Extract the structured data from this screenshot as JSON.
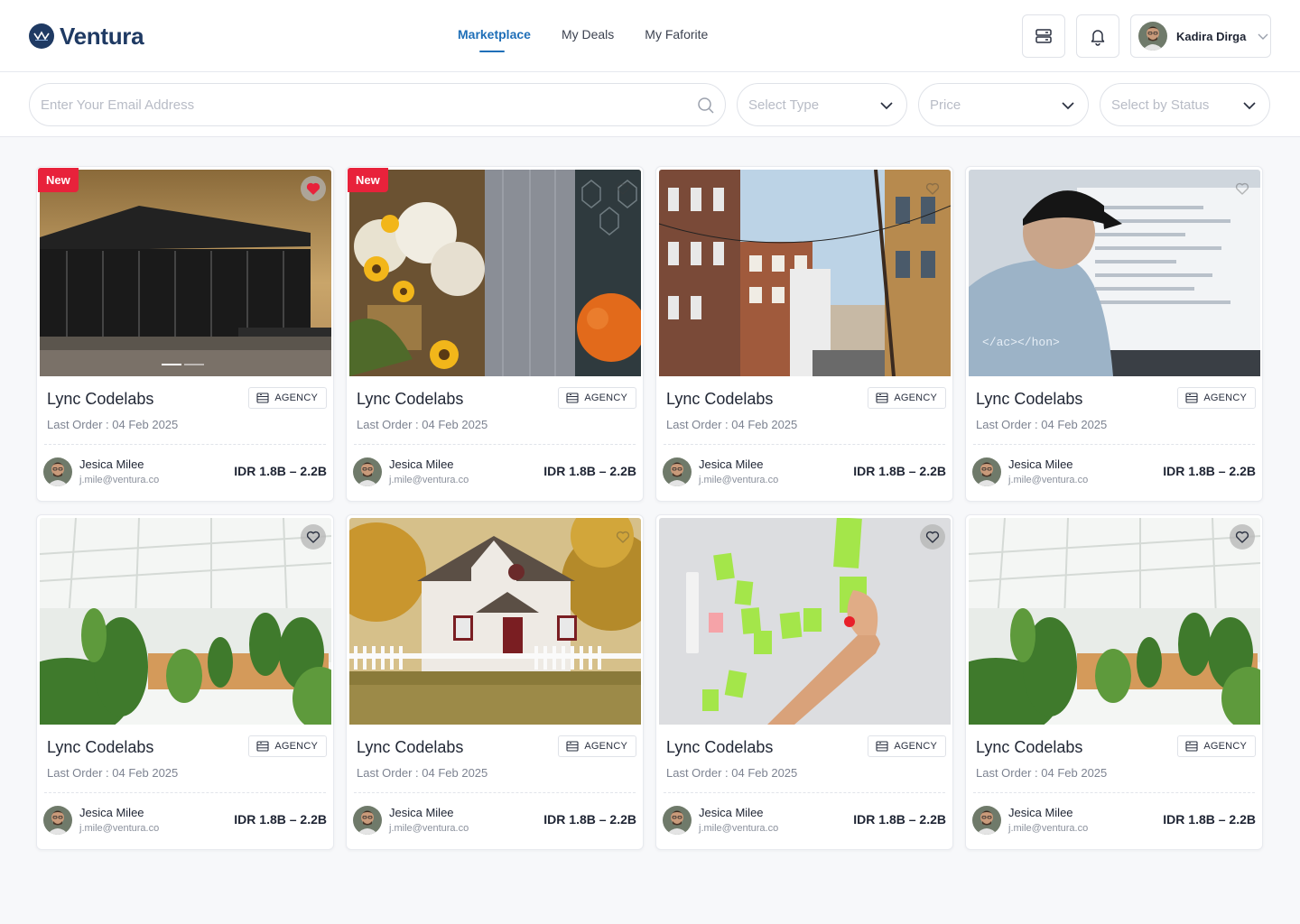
{
  "brand": {
    "name": "Ventura",
    "mark_text": "VENTURA"
  },
  "nav": [
    {
      "label": "Marketplace",
      "active": true
    },
    {
      "label": "My Deals",
      "active": false
    },
    {
      "label": "My Faforite",
      "active": false
    }
  ],
  "header_icons": [
    "server-icon",
    "bell-icon"
  ],
  "user": {
    "name": "Kadira Dirga"
  },
  "filters": {
    "search_placeholder": "Enter Your Email Address",
    "type_placeholder": "Select Type",
    "price_placeholder": "Price",
    "status_placeholder": "Select by Status"
  },
  "colors": {
    "brand": "#1f3a63",
    "accent": "#1f6fb8",
    "badge_new": "#e8223b",
    "favorite_active": "#e8223b"
  },
  "cards": [
    {
      "title": "Lync Codelabs",
      "tag": "AGENCY",
      "last_order": "Last Order : 04 Feb 2025",
      "owner_name": "Jesica Milee",
      "owner_email": "j.mile@ventura.co",
      "price": "IDR 1.8B – 2.2B",
      "is_new": true,
      "new_label": "New",
      "favorited": true,
      "image": "restaurant-dusk"
    },
    {
      "title": "Lync Codelabs",
      "tag": "AGENCY",
      "last_order": "Last Order : 04 Feb 2025",
      "owner_name": "Jesica Milee",
      "owner_email": "j.mile@ventura.co",
      "price": "IDR 1.8B – 2.2B",
      "is_new": true,
      "new_label": "New",
      "favorited": false,
      "image": "flowers-wood"
    },
    {
      "title": "Lync Codelabs",
      "tag": "AGENCY",
      "last_order": "Last Order : 04 Feb 2025",
      "owner_name": "Jesica Milee",
      "owner_email": "j.mile@ventura.co",
      "price": "IDR 1.8B – 2.2B",
      "is_new": false,
      "new_label": "",
      "favorited": false,
      "image": "city-street"
    },
    {
      "title": "Lync Codelabs",
      "tag": "AGENCY",
      "last_order": "Last Order : 04 Feb 2025",
      "owner_name": "Jesica Milee",
      "owner_email": "j.mile@ventura.co",
      "price": "IDR 1.8B – 2.2B",
      "is_new": false,
      "new_label": "",
      "favorited": false,
      "image": "developer-monitor"
    },
    {
      "title": "Lync Codelabs",
      "tag": "AGENCY",
      "last_order": "Last Order : 04 Feb 2025",
      "owner_name": "Jesica Milee",
      "owner_email": "j.mile@ventura.co",
      "price": "IDR 1.8B – 2.2B",
      "is_new": false,
      "new_label": "",
      "favorited": false,
      "image": "greenhouse"
    },
    {
      "title": "Lync Codelabs",
      "tag": "AGENCY",
      "last_order": "Last Order : 04 Feb 2025",
      "owner_name": "Jesica Milee",
      "owner_email": "j.mile@ventura.co",
      "price": "IDR 1.8B – 2.2B",
      "is_new": false,
      "new_label": "",
      "favorited": false,
      "image": "white-house"
    },
    {
      "title": "Lync Codelabs",
      "tag": "AGENCY",
      "last_order": "Last Order : 04 Feb 2025",
      "owner_name": "Jesica Milee",
      "owner_email": "j.mile@ventura.co",
      "price": "IDR 1.8B – 2.2B",
      "is_new": false,
      "new_label": "",
      "favorited": false,
      "image": "sticky-notes"
    },
    {
      "title": "Lync Codelabs",
      "tag": "AGENCY",
      "last_order": "Last Order : 04 Feb 2025",
      "owner_name": "Jesica Milee",
      "owner_email": "j.mile@ventura.co",
      "price": "IDR 1.8B – 2.2B",
      "is_new": false,
      "new_label": "",
      "favorited": false,
      "image": "greenhouse"
    }
  ]
}
